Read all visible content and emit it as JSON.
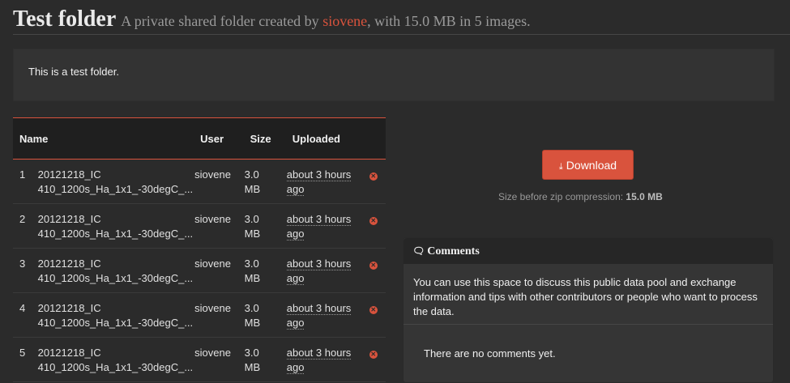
{
  "header": {
    "title": "Test folder",
    "subtitle_prefix": "A private shared folder created by",
    "owner": "siovene",
    "subtitle_suffix": ", with 15.0 MB in 5 images."
  },
  "description": "This is a test folder.",
  "table": {
    "columns": {
      "name": "Name",
      "user": "User",
      "size": "Size",
      "uploaded": "Uploaded"
    },
    "rows": [
      {
        "num": "1",
        "name_line1": "20121218_IC",
        "name_line2": "410_1200s_Ha_1x1_-30degC_...",
        "user": "siovene",
        "size_line1": "3.0",
        "size_line2": "MB",
        "uploaded_line1": "about 3 hours",
        "uploaded_line2": "ago"
      },
      {
        "num": "2",
        "name_line1": "20121218_IC",
        "name_line2": "410_1200s_Ha_1x1_-30degC_...",
        "user": "siovene",
        "size_line1": "3.0",
        "size_line2": "MB",
        "uploaded_line1": "about 3 hours",
        "uploaded_line2": "ago"
      },
      {
        "num": "3",
        "name_line1": "20121218_IC",
        "name_line2": "410_1200s_Ha_1x1_-30degC_...",
        "user": "siovene",
        "size_line1": "3.0",
        "size_line2": "MB",
        "uploaded_line1": "about 3 hours",
        "uploaded_line2": "ago"
      },
      {
        "num": "4",
        "name_line1": "20121218_IC",
        "name_line2": "410_1200s_Ha_1x1_-30degC_...",
        "user": "siovene",
        "size_line1": "3.0",
        "size_line2": "MB",
        "uploaded_line1": "about 3 hours",
        "uploaded_line2": "ago"
      },
      {
        "num": "5",
        "name_line1": "20121218_IC",
        "name_line2": "410_1200s_Ha_1x1_-30degC_...",
        "user": "siovene",
        "size_line1": "3.0",
        "size_line2": "MB",
        "uploaded_line1": "about 3 hours",
        "uploaded_line2": "ago"
      }
    ]
  },
  "download": {
    "label": "Download",
    "icon": "download-icon",
    "size_label": "Size before zip compression:",
    "size_value": "15.0 MB"
  },
  "comments": {
    "title": "Comments",
    "icon": "comment-icon",
    "intro": "You can use this space to discuss this public data pool and exchange information and tips with other contributors or people who want to process the data.",
    "empty": "There are no comments yet."
  },
  "colors": {
    "accent": "#d9533d",
    "background": "#2b2b2b"
  }
}
